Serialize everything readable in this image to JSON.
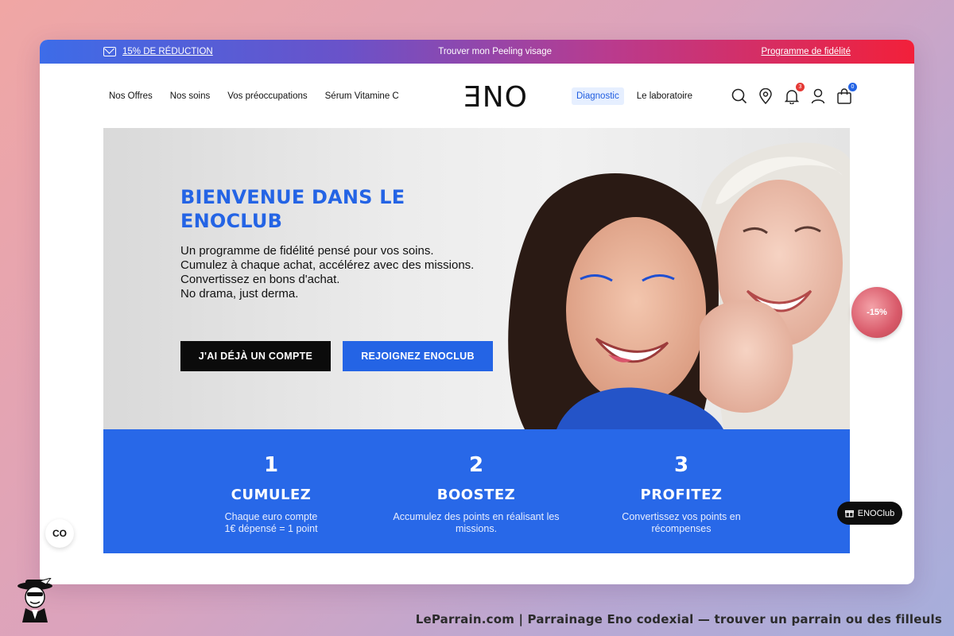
{
  "promo": {
    "left_text": "15% DE RÉDUCTION",
    "center_text": "Trouver mon Peeling visage",
    "right_text": "Programme de fidélité"
  },
  "nav": {
    "left_links": [
      "Nos Offres",
      "Nos soins",
      "Vos préoccupations",
      "Sérum Vitamine C"
    ],
    "logo": "ƎNO",
    "diagnostic": "Diagnostic",
    "laboratory": "Le laboratoire",
    "notifications_count": "3",
    "cart_count": "0",
    "colors": {
      "accent": "#2464e5",
      "badge_red": "#e53935",
      "badge_blue": "#2464e5"
    }
  },
  "hero": {
    "title": "BIENVENUE DANS LE ENOCLUB",
    "description": [
      "Un programme de fidélité pensé pour vos soins.",
      "Cumulez à chaque achat, accélérez avec des missions.",
      "Convertissez en bons d'achat.",
      "No drama, just derma."
    ],
    "btn_login": "J'AI DÉJÀ UN COMPTE",
    "btn_join": "REJOIGNEZ ENOCLUB"
  },
  "steps": [
    {
      "num": "1",
      "title": "CUMULEZ",
      "text": "Chaque euro compte\n1€ dépensé = 1 point"
    },
    {
      "num": "2",
      "title": "BOOSTEZ",
      "text": "Accumulez des points en réalisant les\nmissions."
    },
    {
      "num": "3",
      "title": "PROFITEZ",
      "text": "Convertissez vos points en\nrécompenses"
    }
  ],
  "floating": {
    "discount": "-15%",
    "club": "ENOClub",
    "co": "CO"
  },
  "footer": {
    "caption": "LeParrain.com | Parrainage Eno codexial — trouver un parrain ou des filleuls"
  }
}
